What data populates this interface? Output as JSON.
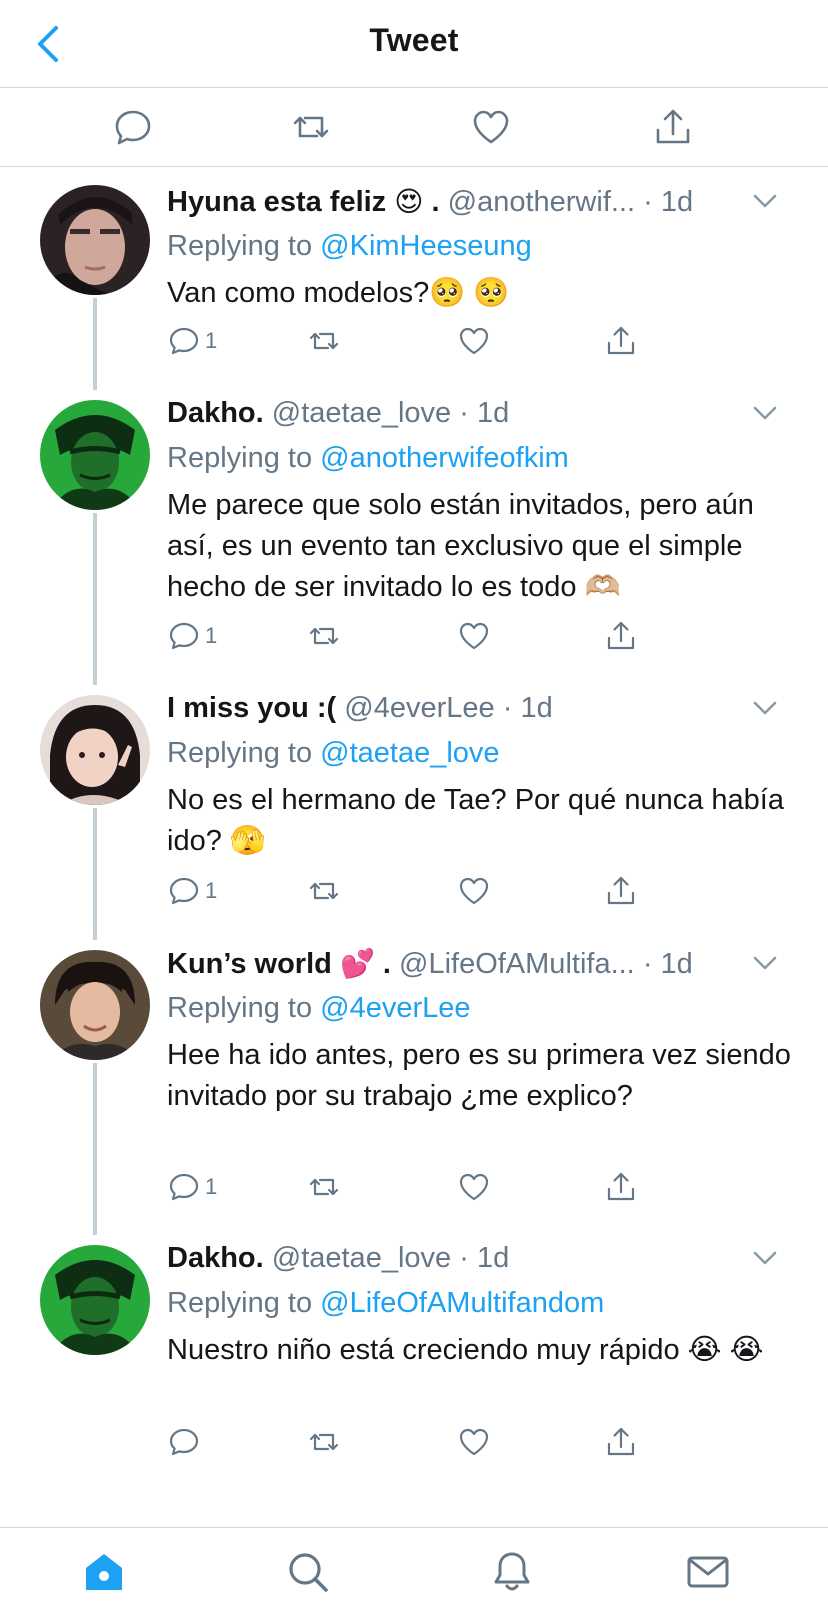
{
  "header": {
    "title": "Tweet"
  },
  "replies": [
    {
      "name": "Hyuna esta feliz",
      "name_emoji": "😍",
      "name_suffix": " .",
      "handle": "@anotherwif...",
      "dot": "·",
      "time": "1d",
      "replying_label": "Replying to",
      "replying_to": "@KimHeeseung",
      "text": "Van como modelos?🥺 🥺",
      "reply_count": "1"
    },
    {
      "name": "Dakho.",
      "name_emoji": "",
      "name_suffix": "",
      "handle": "@taetae_love",
      "dot": "·",
      "time": "1d",
      "replying_label": "Replying to",
      "replying_to": "@anotherwifeofkim",
      "text": "Me parece que solo están invitados, pero aún así, es un evento tan exclusivo que el simple hecho de ser invitado lo es todo 🫶🏼",
      "reply_count": "1"
    },
    {
      "name": "I miss you :(",
      "name_emoji": "",
      "name_suffix": "",
      "handle": "@4everLee",
      "dot": "·",
      "time": "1d",
      "replying_label": "Replying to",
      "replying_to": "@taetae_love",
      "text": "No es el hermano de Tae? Por qué nunca había ido? 🫣",
      "reply_count": "1"
    },
    {
      "name": "Kun’s world",
      "name_emoji": "💕",
      "name_suffix": " .",
      "handle": "@LifeOfAMultifa...",
      "dot": "·",
      "time": "1d",
      "replying_label": "Replying to",
      "replying_to": "@4everLee",
      "text": "Hee ha ido antes, pero es su primera vez siendo invitado por su trabajo ¿me explico?",
      "reply_count": "1"
    },
    {
      "name": "Dakho.",
      "name_emoji": "",
      "name_suffix": "",
      "handle": "@taetae_love",
      "dot": "·",
      "time": "1d",
      "replying_label": "Replying to",
      "replying_to": "@LifeOfAMultifandom",
      "text": "Nuestro niño está creciendo muy rápido 😭 😭",
      "reply_count": ""
    }
  ],
  "icons": {
    "header": [
      "back-icon"
    ],
    "actions": [
      "reply-icon",
      "retweet-icon",
      "like-icon",
      "share-icon"
    ],
    "tabs": [
      "home-icon",
      "search-icon",
      "notifications-icon",
      "messages-icon"
    ]
  },
  "colors": {
    "accent": "#1da1f2",
    "tab_active": "#1da1f2",
    "muted": "#657786"
  }
}
